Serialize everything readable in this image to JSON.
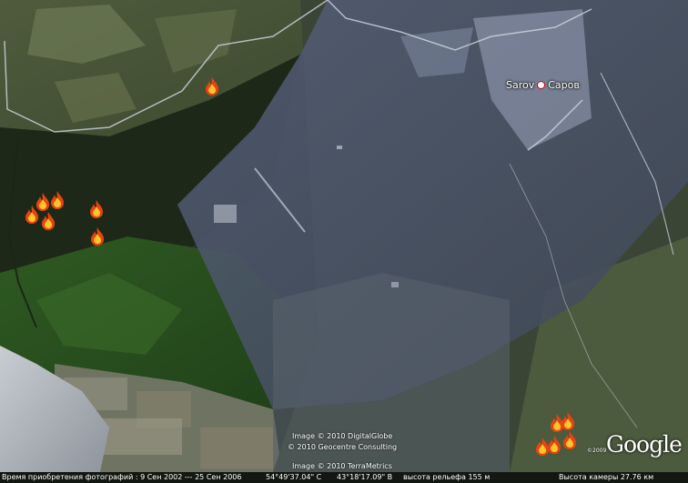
{
  "city": {
    "latin": "Sarov",
    "cyrillic": "Саров",
    "label": "Sarov  Саров"
  },
  "attribution": {
    "line1": "Image © 2010 DigitalGlobe",
    "line2": "© 2010 Geocentre Consulting",
    "line3": "Image © 2010 TerraMetrics"
  },
  "logo": {
    "text": "Google",
    "year": "©2009"
  },
  "status_bar": {
    "imagery_dates": "Время приобретения фотографий : 9 Сен 2002 --- 25 Сен 2006",
    "latitude": "54°49'37.04\" С",
    "longitude": "43°18'17.09\" В",
    "elevation": "высота рельефа  155 м",
    "eye_altitude": "Высота камеры   27.76 км"
  },
  "colors": {
    "forest": "#25301f",
    "field": "#5d6a48",
    "overlay": "#6f7a90",
    "road": "#d8dde6",
    "fire": "#f5a623"
  },
  "fire_icons": [
    "fire-icon",
    "fire-icon",
    "fire-icon",
    "fire-icon",
    "fire-icon",
    "fire-icon",
    "fire-icon",
    "fire-icon",
    "fire-icon",
    "fire-icon",
    "fire-icon",
    "fire-icon"
  ]
}
